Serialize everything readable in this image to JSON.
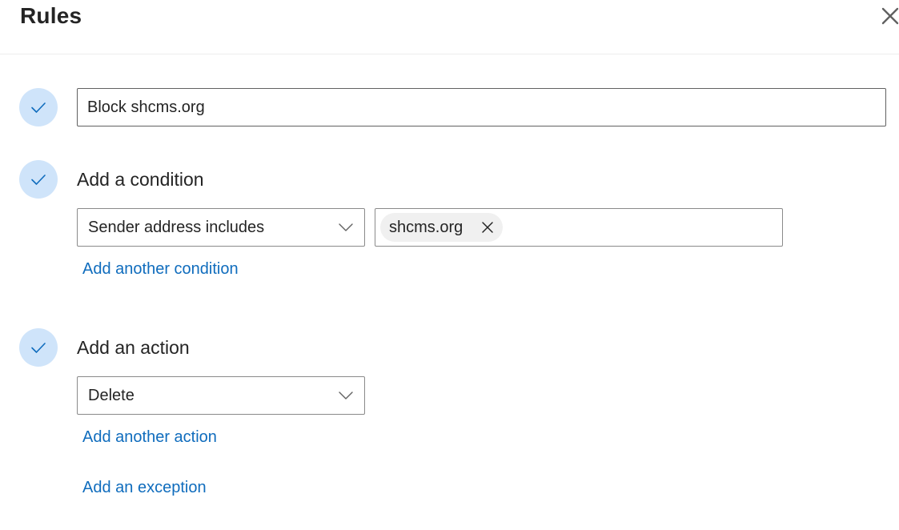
{
  "dialog": {
    "title": "Rules",
    "close_icon": "close-icon"
  },
  "rule_name": {
    "value": "Block shcms.org",
    "step_icon": "checkmark-icon"
  },
  "condition": {
    "heading": "Add a condition",
    "step_icon": "checkmark-icon",
    "selected": "Sender address includes",
    "tags": [
      "shcms.org"
    ],
    "add_another_label": "Add another condition"
  },
  "action": {
    "heading": "Add an action",
    "step_icon": "checkmark-icon",
    "selected": "Delete",
    "add_another_label": "Add another action"
  },
  "exception": {
    "add_label": "Add an exception"
  },
  "colors": {
    "link": "#0f6cbd",
    "step_circle": "#cfe4fa",
    "check": "#0f6cbd",
    "chip": "#f0f0f0"
  }
}
